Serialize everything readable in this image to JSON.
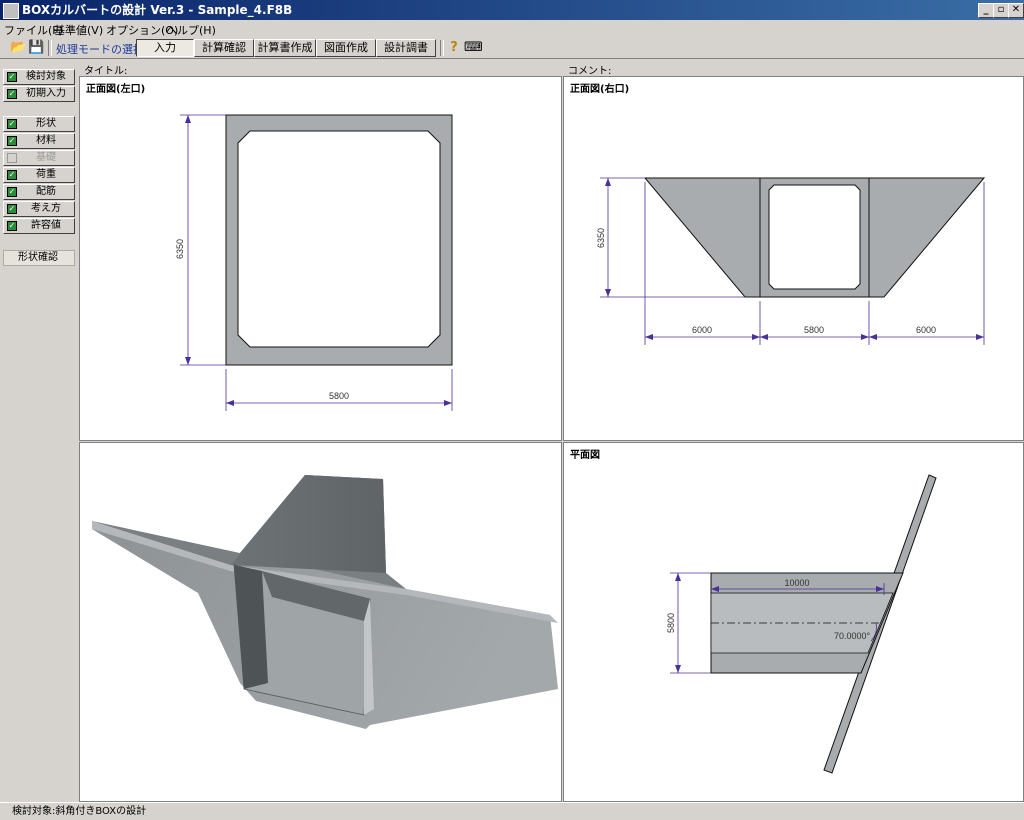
{
  "window": {
    "title": "BOXカルバートの設計 Ver.3 - Sample_4.F8B",
    "minimize": "_",
    "restore": "▫",
    "close": "✕"
  },
  "menu": [
    "ファイル(F)",
    "基準値(V)",
    "オプション(O)",
    "ヘルプ(H)"
  ],
  "toolbar": {
    "mode_label": "処理モードの選択",
    "tabs": [
      "入力",
      "計算確認",
      "計算書作成",
      "図面作成",
      "設計調書"
    ],
    "active_tab": "入力",
    "icons": [
      "folder-open-icon",
      "save-icon",
      "help-icon",
      "keyboard-icon"
    ]
  },
  "nav": {
    "items": [
      {
        "label": "検討対象",
        "checked": true
      },
      {
        "label": "初期入力",
        "checked": true
      },
      {
        "label": "形状",
        "checked": true
      },
      {
        "label": "材料",
        "checked": true
      },
      {
        "label": "基礎",
        "checked": false,
        "disabled": true
      },
      {
        "label": "荷重",
        "checked": true
      },
      {
        "label": "配筋",
        "checked": true
      },
      {
        "label": "考え方",
        "checked": true
      },
      {
        "label": "許容値",
        "checked": true
      }
    ],
    "shape_confirm": "形状確認"
  },
  "header": {
    "title_label": "タイトル:",
    "comment_label": "コメント:"
  },
  "views": {
    "front_left": {
      "title": "正面図(左口)",
      "height_dim": "6350",
      "width_dim": "5800"
    },
    "front_right": {
      "title": "正面図(右口)",
      "height_dim": "6350",
      "dims": [
        "6000",
        "5800",
        "6000"
      ]
    },
    "plan": {
      "title": "平面図",
      "length_dim": "10000",
      "width_dim": "5800",
      "angle": "70.0000°"
    }
  },
  "status": "検討対象:斜角付きBOXの設計"
}
